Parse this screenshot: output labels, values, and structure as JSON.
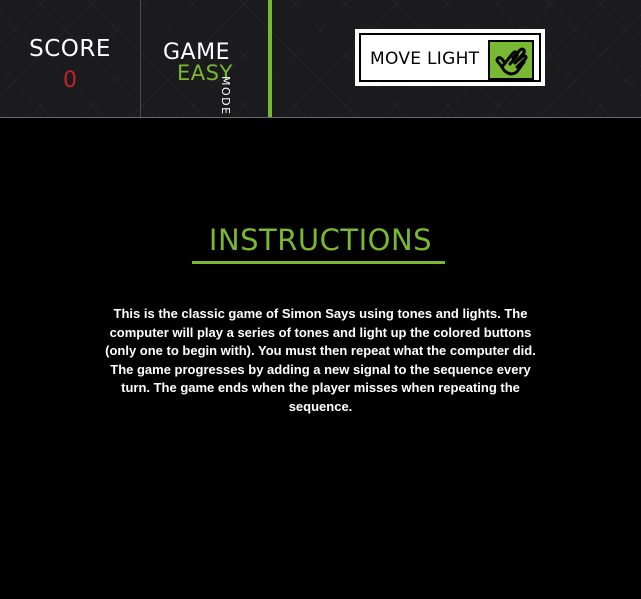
{
  "header": {
    "score_label": "SCORE",
    "score_value": "0",
    "game_label": "GAME",
    "mode_value": "EASY",
    "mode_label": "MODE",
    "move_light_label": "MOVE LIGHT",
    "move_light_icon": "hand-icon"
  },
  "instructions": {
    "title": "INSTRUCTIONS",
    "body": "This is the classic game of Simon Says using tones and lights. The computer will play a series of tones and light up the colored buttons (only one to begin with). You must then repeat what the computer did. The game progresses by adding a new signal to the sequence every turn. The game ends when the player misses when repeating the sequence."
  },
  "colors": {
    "accent_green": "#78b832",
    "score_red": "#c2222c",
    "background": "#000000",
    "header_bg": "#1b1b1d"
  }
}
